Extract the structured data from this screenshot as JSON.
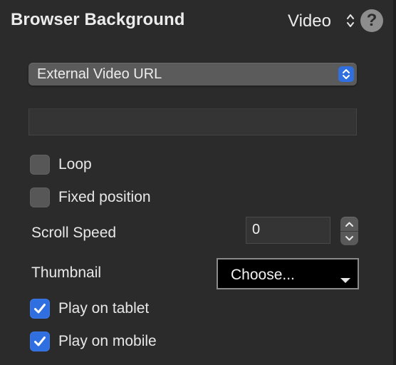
{
  "header": {
    "title": "Browser Background",
    "mode_value": "Video",
    "help_symbol": "?"
  },
  "source_select": {
    "selected": "External Video URL"
  },
  "url_field": {
    "value": ""
  },
  "options": {
    "loop": {
      "label": "Loop",
      "checked": false
    },
    "fixed_position": {
      "label": "Fixed position",
      "checked": false
    }
  },
  "scroll_speed": {
    "label": "Scroll Speed",
    "value": "0"
  },
  "thumbnail": {
    "label": "Thumbnail",
    "button_label": "Choose..."
  },
  "playback": {
    "tablet": {
      "label": "Play on tablet",
      "checked": true
    },
    "mobile": {
      "label": "Play on mobile",
      "checked": true
    }
  },
  "colors": {
    "accent": "#2f6fe0",
    "panel_bg": "#2b2b2b",
    "text": "#e8e8e8"
  }
}
